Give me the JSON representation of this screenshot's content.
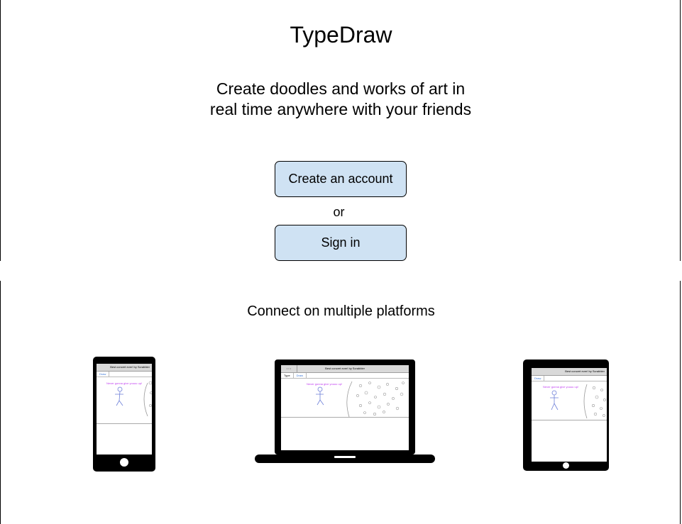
{
  "app_title": "TypeDraw",
  "tagline": "Create doodles and works of art in real time anywhere with your friends",
  "buttons": {
    "create_account": "Create an account",
    "or": "or",
    "sign_in": "Sign in"
  },
  "platforms_heading": "Connect on multiple platforms",
  "device_preview": {
    "title": "Best concert ever! by Scrabbler",
    "laptop_title": "Best concert ever! by Scrabbler",
    "menu_label": "• • •",
    "type_tool": "Type",
    "draw_tool": "Draw",
    "message": "Never gonna give youuu up!"
  },
  "colors": {
    "button_fill": "#cfe2f3",
    "doodle_stroke": "#6d7fd8",
    "message_text": "#c13ff0"
  }
}
